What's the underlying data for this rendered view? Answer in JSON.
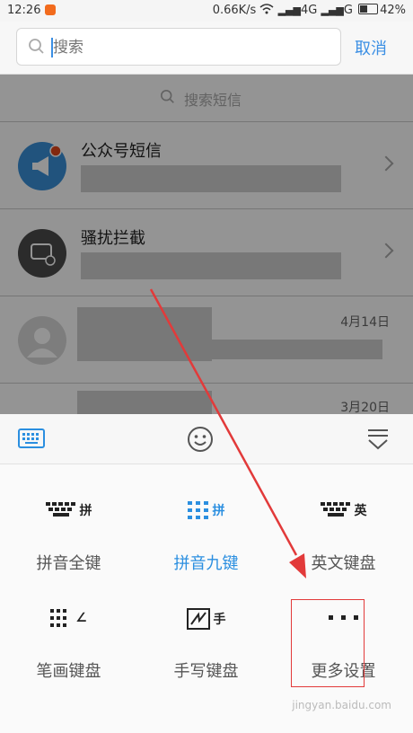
{
  "status_bar": {
    "time": "12:26",
    "network_speed": "0.66K/s",
    "signal": "4G",
    "signal2": "G",
    "battery": "42%"
  },
  "search": {
    "placeholder": "搜索",
    "cancel_label": "取消"
  },
  "conversation_list": {
    "search_hint": "搜索短信",
    "rows": [
      {
        "title": "公众号短信",
        "date": ""
      },
      {
        "title": "骚扰拦截",
        "date": ""
      },
      {
        "title": "",
        "date": "4月14日"
      },
      {
        "title": "",
        "date": "3月20日"
      }
    ]
  },
  "keyboard": {
    "toolbar": {
      "left_icon": "keyboard-icon",
      "center_icon": "emoji-icon",
      "right_icon": "collapse-keyboard-icon"
    },
    "options": [
      {
        "label": "拼音全键",
        "key_char": "拼",
        "icon": "full-keyboard-icon",
        "active": false
      },
      {
        "label": "拼音九键",
        "key_char": "拼",
        "icon": "nine-key-icon",
        "active": true
      },
      {
        "label": "英文键盘",
        "key_char": "英",
        "icon": "english-keyboard-icon",
        "active": false
      },
      {
        "label": "笔画键盘",
        "key_char": "∠",
        "icon": "stroke-keyboard-icon",
        "active": false
      },
      {
        "label": "手写键盘",
        "key_char": "手",
        "icon": "handwriting-icon",
        "active": false
      },
      {
        "label": "更多设置",
        "key_char": "",
        "icon": "more-dots-icon",
        "active": false
      }
    ],
    "accent_color": "#2b8fe0"
  },
  "annotation": {
    "highlight_color": "#e23a3a"
  },
  "watermark": "jingyan.baidu.com"
}
